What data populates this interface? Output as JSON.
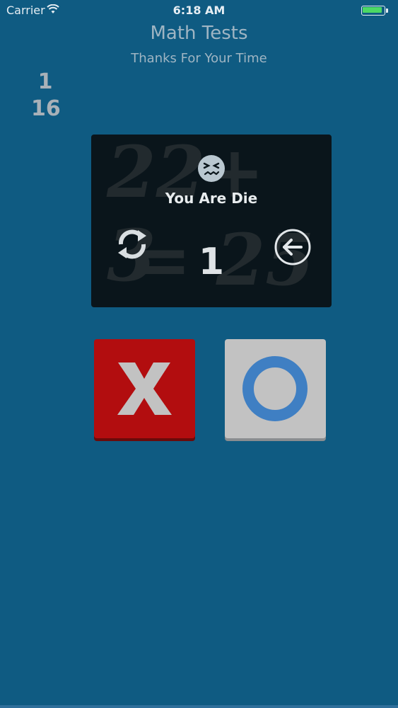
{
  "status_bar": {
    "carrier": "Carrier",
    "time": "6:18 AM",
    "battery_color": "#4cd964"
  },
  "header": {
    "title": "Math Tests",
    "subtitle": "Thanks For Your Time"
  },
  "scores": {
    "current": "1",
    "total": "16"
  },
  "panel": {
    "bg_equation_top": "22+ 3",
    "bg_equation_bottom": "= 25",
    "face_icon": "confounded-face-icon",
    "message": "You Are Die",
    "score": "1",
    "retry_icon": "refresh-icon",
    "back_icon": "back-arrow-icon"
  },
  "buttons": {
    "wrong": {
      "label": "X",
      "color": "#b20d0f",
      "glyph_color": "#c2c2c2"
    },
    "right": {
      "label": "O",
      "color": "#c2c2c2",
      "glyph_color": "#3f7fc3"
    }
  },
  "colors": {
    "background": "#0f5b82",
    "panel": "#0a151b"
  }
}
